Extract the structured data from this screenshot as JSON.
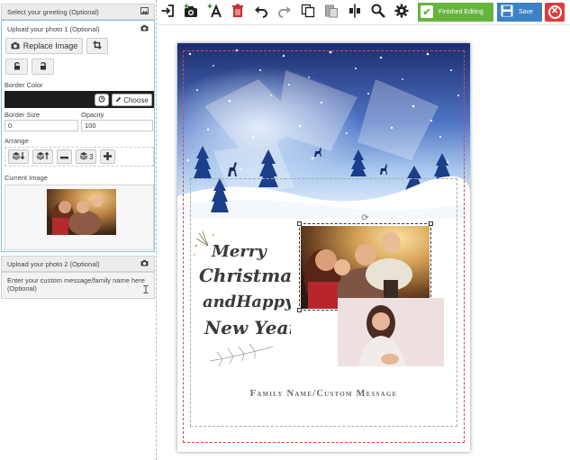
{
  "left_panel": {
    "greeting_section": {
      "title": "Select your greeting (Optional)",
      "icon": "image-icon"
    },
    "photo1_section": {
      "title": "Upload your photo 1 (Optional)",
      "icon": "camera-icon",
      "replace_label": "Replace Image",
      "border_color_label": "Border Color",
      "border_color_value": "#1d1d1d",
      "choose_label": "Choose",
      "border_size_label": "Border Size",
      "border_size_value": "0",
      "opacity_label": "Opacity",
      "opacity_value": "100",
      "arrange_label": "Arrange",
      "layer_number": "3",
      "current_image_label": "Current Image"
    },
    "photo2_section": {
      "title": "Upload your photo 2 (Optional)",
      "icon": "camera-icon"
    },
    "message_section": {
      "title": "Enter your custom message/family name here (Optional)"
    }
  },
  "toolbar": {
    "finished_label": "Finished Editing",
    "save_label": "Save",
    "accent_green": "#65b53d",
    "accent_blue": "#3d82c7",
    "accent_red": "#e03a3a"
  },
  "card": {
    "greeting_lines": [
      "Merry",
      "Christmas",
      "andHappy",
      "New Year"
    ],
    "family_message": "Family Name/Custom Message"
  }
}
